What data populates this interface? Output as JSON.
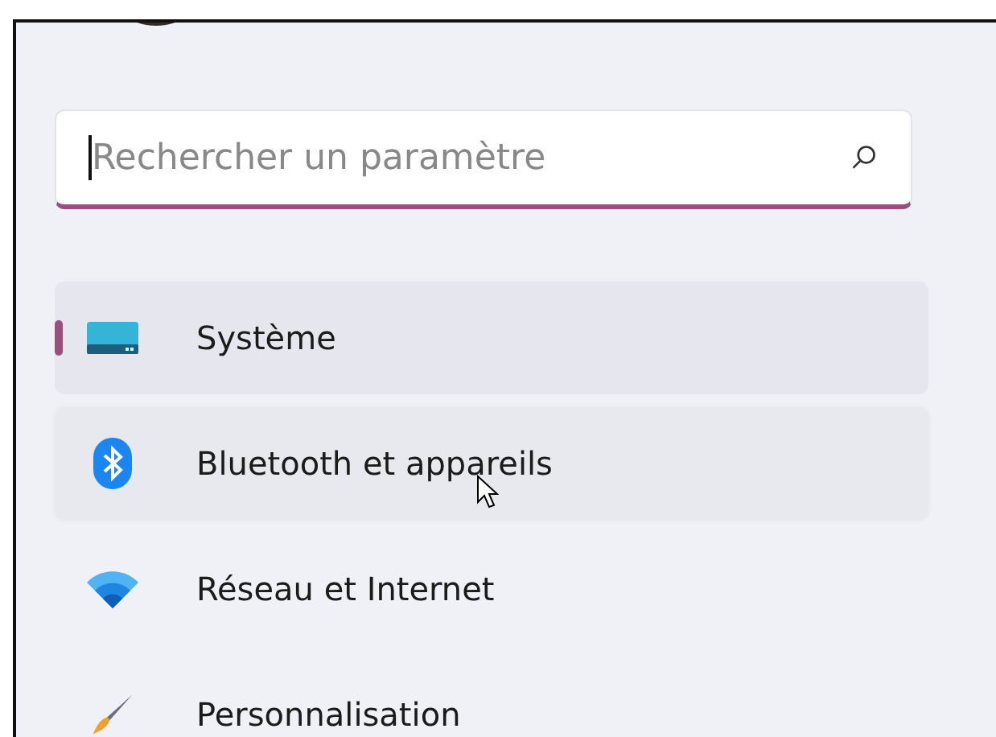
{
  "search": {
    "placeholder": "Rechercher un paramètre",
    "focused": true
  },
  "nav": [
    {
      "label": "Système",
      "selected": true,
      "hovered": false
    },
    {
      "label": "Bluetooth et appareils",
      "selected": false,
      "hovered": true
    },
    {
      "label": "Réseau et Internet",
      "selected": false,
      "hovered": false
    },
    {
      "label": "Personnalisation",
      "selected": false,
      "hovered": false
    }
  ]
}
